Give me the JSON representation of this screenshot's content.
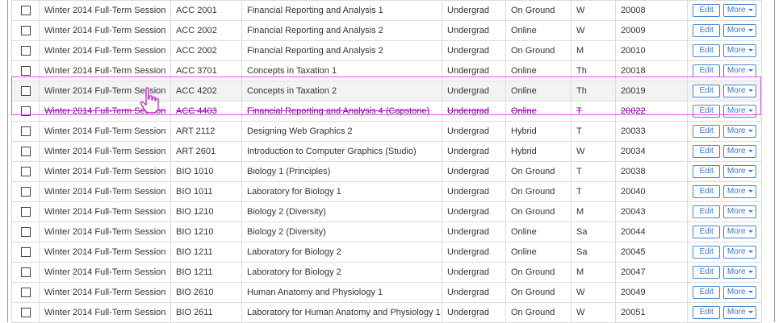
{
  "buttons": {
    "edit": "Edit",
    "more": "More"
  },
  "rows": [
    {
      "session": "Winter 2014 Full-Term Session",
      "course": "ACC 2001",
      "title": "Financial Reporting and Analysis 1",
      "level": "Undergrad",
      "mode": "On Ground",
      "day": "W",
      "crn": "20008"
    },
    {
      "session": "Winter 2014 Full-Term Session",
      "course": "ACC 2002",
      "title": "Financial Reporting and Analysis 2",
      "level": "Undergrad",
      "mode": "Online",
      "day": "W",
      "crn": "20009"
    },
    {
      "session": "Winter 2014 Full-Term Session",
      "course": "ACC 2002",
      "title": "Financial Reporting and Analysis 2",
      "level": "Undergrad",
      "mode": "On Ground",
      "day": "M",
      "crn": "20010"
    },
    {
      "session": "Winter 2014 Full-Term Session",
      "course": "ACC 3701",
      "title": "Concepts in Taxation 1",
      "level": "Undergrad",
      "mode": "Online",
      "day": "Th",
      "crn": "20018"
    },
    {
      "session": "Winter 2014 Full-Term Session",
      "course": "ACC 4202",
      "title": "Concepts in Taxation 2",
      "level": "Undergrad",
      "mode": "Online",
      "day": "Th",
      "crn": "20019"
    },
    {
      "session": "Winter 2014 Full-Term Session",
      "course": "ACC 4403",
      "title": "Financial Reporting and Analysis 4 (Capstone)",
      "level": "Undergrad",
      "mode": "Online",
      "day": "T",
      "crn": "20022"
    },
    {
      "session": "Winter 2014 Full-Term Session",
      "course": "ART 2112",
      "title": "Designing Web Graphics 2",
      "level": "Undergrad",
      "mode": "Hybrid",
      "day": "T",
      "crn": "20033"
    },
    {
      "session": "Winter 2014 Full-Term Session",
      "course": "ART 2601",
      "title": "Introduction to Computer Graphics (Studio)",
      "level": "Undergrad",
      "mode": "Hybrid",
      "day": "W",
      "crn": "20034"
    },
    {
      "session": "Winter 2014 Full-Term Session",
      "course": "BIO 1010",
      "title": "Biology 1 (Principles)",
      "level": "Undergrad",
      "mode": "On Ground",
      "day": "T",
      "crn": "20038"
    },
    {
      "session": "Winter 2014 Full-Term Session",
      "course": "BIO 1011",
      "title": "Laboratory for Biology 1",
      "level": "Undergrad",
      "mode": "On Ground",
      "day": "T",
      "crn": "20040"
    },
    {
      "session": "Winter 2014 Full-Term Session",
      "course": "BIO 1210",
      "title": "Biology 2 (Diversity)",
      "level": "Undergrad",
      "mode": "On Ground",
      "day": "M",
      "crn": "20043"
    },
    {
      "session": "Winter 2014 Full-Term Session",
      "course": "BIO 1210",
      "title": "Biology 2 (Diversity)",
      "level": "Undergrad",
      "mode": "Online",
      "day": "Sa",
      "crn": "20044"
    },
    {
      "session": "Winter 2014 Full-Term Session",
      "course": "BIO 1211",
      "title": "Laboratory for Biology 2",
      "level": "Undergrad",
      "mode": "Online",
      "day": "Sa",
      "crn": "20045"
    },
    {
      "session": "Winter 2014 Full-Term Session",
      "course": "BIO 1211",
      "title": "Laboratory for Biology 2",
      "level": "Undergrad",
      "mode": "On Ground",
      "day": "M",
      "crn": "20047"
    },
    {
      "session": "Winter 2014 Full-Term Session",
      "course": "BIO 2610",
      "title": "Human Anatomy and Physiology 1",
      "level": "Undergrad",
      "mode": "On Ground",
      "day": "W",
      "crn": "20049"
    },
    {
      "session": "Winter 2014 Full-Term Session",
      "course": "BIO 2611",
      "title": "Laboratory for Human Anatomy and Physiology 1",
      "level": "Undergrad",
      "mode": "On Ground",
      "day": "W",
      "crn": "20051"
    }
  ],
  "highlight_row_index": 4,
  "strike_row_index": 5,
  "colors": {
    "selection_outline": "#e14ee8",
    "button_border": "#4a86c8",
    "button_text": "#3a78c3",
    "row_highlight": "#f3f3f3"
  }
}
